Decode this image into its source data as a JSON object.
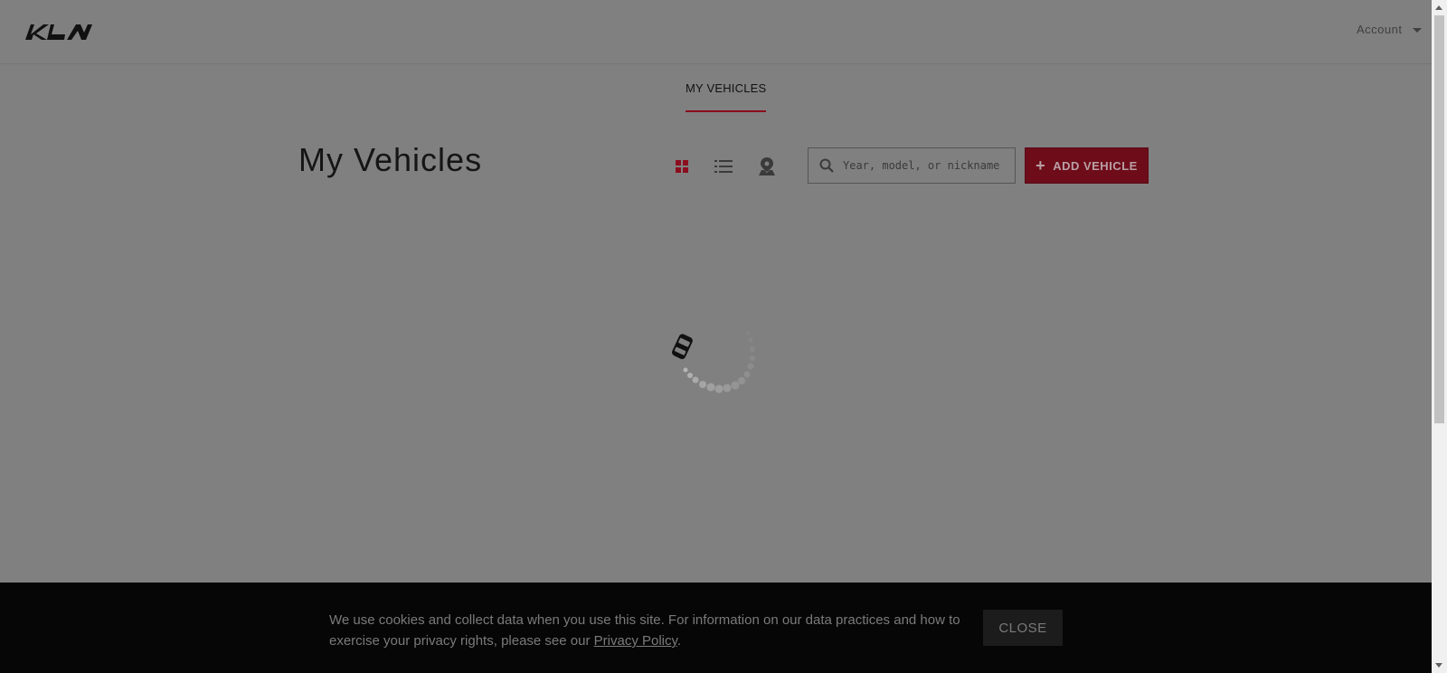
{
  "header": {
    "logo_text": "KIA",
    "account_label": "Account"
  },
  "nav": {
    "tabs": [
      {
        "label": "MY VEHICLES",
        "active": true
      }
    ]
  },
  "main": {
    "title": "My Vehicles",
    "views": [
      {
        "icon": "grid-view-icon",
        "active": true
      },
      {
        "icon": "list-view-icon",
        "active": false
      },
      {
        "icon": "map-view-icon",
        "active": false
      }
    ],
    "search": {
      "placeholder": "Year, model, or nickname",
      "value": ""
    },
    "add_button_label": "ADD VEHICLE"
  },
  "cookie_banner": {
    "text": "We use cookies and collect data when you use this site. For information on our data practices and how to exercise your privacy rights, please see our ",
    "link_text": "Privacy Policy",
    "suffix": ".",
    "close_label": "CLOSE"
  },
  "colors": {
    "accent": "#8b0d1e",
    "overlay": "#808080",
    "banner": "#060606"
  }
}
